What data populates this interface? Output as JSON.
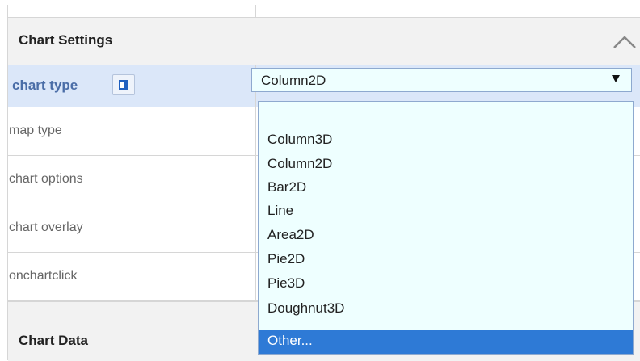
{
  "panel": {
    "settings_title": "Chart Settings",
    "data_title": "Chart Data"
  },
  "rows": [
    {
      "label": "chart type"
    },
    {
      "label": "map type"
    },
    {
      "label": "chart options"
    },
    {
      "label": "chart overlay"
    },
    {
      "label": "onchartclick"
    }
  ],
  "chart_type_select": {
    "selected": "Column2D",
    "options": [
      "",
      "Column3D",
      "Column2D",
      "Bar2D",
      "Line",
      "Area2D",
      "Pie2D",
      "Pie3D",
      "Doughnut3D",
      "Other..."
    ],
    "highlighted": "Other..."
  },
  "colors": {
    "active_row": "#dbe7f9",
    "active_label": "#4a6da7",
    "dropdown_bg": "#eeffff",
    "highlight": "#2e7ad6"
  },
  "icons": {
    "collapse": "chevron-up-icon",
    "toggle": "toggle-panel-icon",
    "dropdown_arrow": "dropdown-arrow-icon"
  }
}
